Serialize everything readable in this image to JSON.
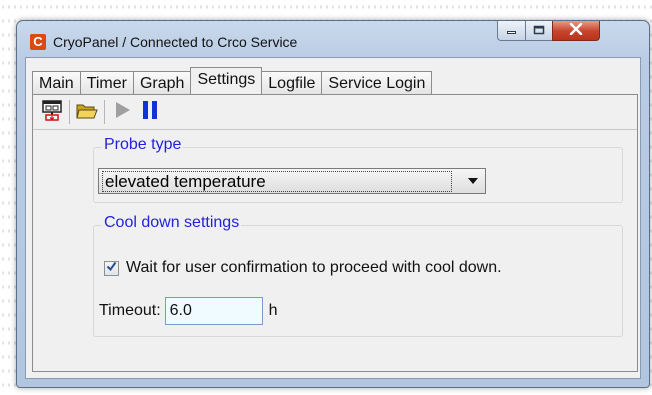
{
  "window": {
    "app_icon_letter": "C",
    "title": "CryoPanel / Connected to Crco Service"
  },
  "tabs": [
    {
      "label": "Main"
    },
    {
      "label": "Timer"
    },
    {
      "label": "Graph"
    },
    {
      "label": "Settings",
      "active": true
    },
    {
      "label": "Logfile"
    },
    {
      "label": "Service Login"
    }
  ],
  "toolbar": {
    "icons": [
      "save-probe-icon",
      "open-folder-icon",
      "play-icon",
      "pause-icon"
    ],
    "play_enabled": false
  },
  "probe_type": {
    "legend": "Probe type",
    "selected": "elevated temperature"
  },
  "cool_down": {
    "legend": "Cool down settings",
    "confirm_label": "Wait for user confirmation to proceed with cool down.",
    "confirm_checked": true,
    "timeout_label": "Timeout:",
    "timeout_value": "6.0",
    "timeout_unit": "h"
  },
  "colors": {
    "legend_blue": "#2222dd",
    "pause_blue": "#1032d8",
    "close_red": "#c7432b"
  }
}
